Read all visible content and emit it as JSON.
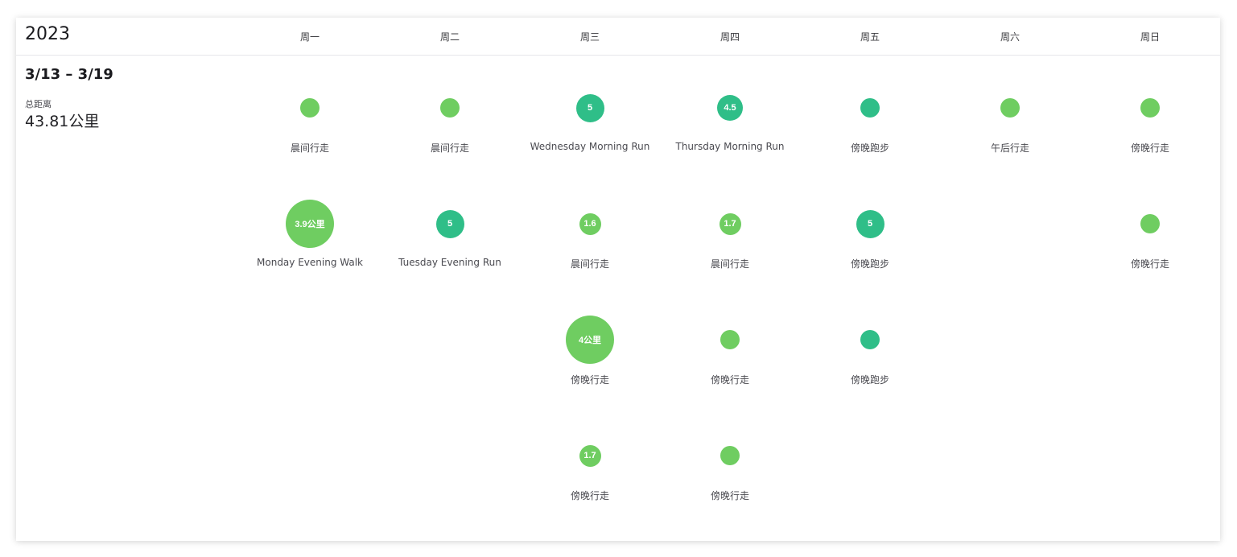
{
  "calendar": {
    "year": "2023",
    "days": [
      "周一",
      "周二",
      "周三",
      "周四",
      "周五",
      "周六",
      "周日"
    ]
  },
  "week": {
    "range": "3/13 – 3/19",
    "distance_label": "总距离",
    "distance_value": "43.81公里"
  },
  "colors": {
    "walk": "#6fcd61",
    "run": "#2fbe88"
  },
  "activities": [
    {
      "day": 0,
      "row": 0,
      "label": "晨间行走",
      "value": "",
      "size": "small",
      "kind": "walk"
    },
    {
      "day": 0,
      "row": 1,
      "label": "Monday Evening Walk",
      "value": "3.9公里",
      "size": "large",
      "kind": "walk"
    },
    {
      "day": 1,
      "row": 0,
      "label": "晨间行走",
      "value": "",
      "size": "small",
      "kind": "walk"
    },
    {
      "day": 1,
      "row": 1,
      "label": "Tuesday Evening Run",
      "value": "5",
      "size": "medium",
      "kind": "run"
    },
    {
      "day": 2,
      "row": 0,
      "label": "Wednesday Morning Run",
      "value": "5",
      "size": "medium",
      "kind": "run"
    },
    {
      "day": 2,
      "row": 1,
      "label": "晨间行走",
      "value": "1.6",
      "size": "small-plus",
      "kind": "walk"
    },
    {
      "day": 2,
      "row": 2,
      "label": "傍晚行走",
      "value": "4公里",
      "size": "large",
      "kind": "walk"
    },
    {
      "day": 2,
      "row": 3,
      "label": "傍晚行走",
      "value": "1.7",
      "size": "small-plus",
      "kind": "walk"
    },
    {
      "day": 3,
      "row": 0,
      "label": "Thursday Morning Run",
      "value": "4.5",
      "size": "medium-minus",
      "kind": "run"
    },
    {
      "day": 3,
      "row": 1,
      "label": "晨间行走",
      "value": "1.7",
      "size": "small-plus",
      "kind": "walk"
    },
    {
      "day": 3,
      "row": 2,
      "label": "傍晚行走",
      "value": "",
      "size": "small",
      "kind": "walk"
    },
    {
      "day": 3,
      "row": 3,
      "label": "傍晚行走",
      "value": "",
      "size": "small",
      "kind": "walk"
    },
    {
      "day": 4,
      "row": 0,
      "label": "傍晚跑步",
      "value": "",
      "size": "small",
      "kind": "run"
    },
    {
      "day": 4,
      "row": 1,
      "label": "傍晚跑步",
      "value": "5",
      "size": "medium",
      "kind": "run"
    },
    {
      "day": 4,
      "row": 2,
      "label": "傍晚跑步",
      "value": "",
      "size": "small",
      "kind": "run"
    },
    {
      "day": 5,
      "row": 0,
      "label": "午后行走",
      "value": "",
      "size": "small",
      "kind": "walk"
    },
    {
      "day": 6,
      "row": 0,
      "label": "傍晚行走",
      "value": "",
      "size": "small",
      "kind": "walk"
    },
    {
      "day": 6,
      "row": 1,
      "label": "傍晚行走",
      "value": "",
      "size": "small",
      "kind": "walk"
    }
  ]
}
